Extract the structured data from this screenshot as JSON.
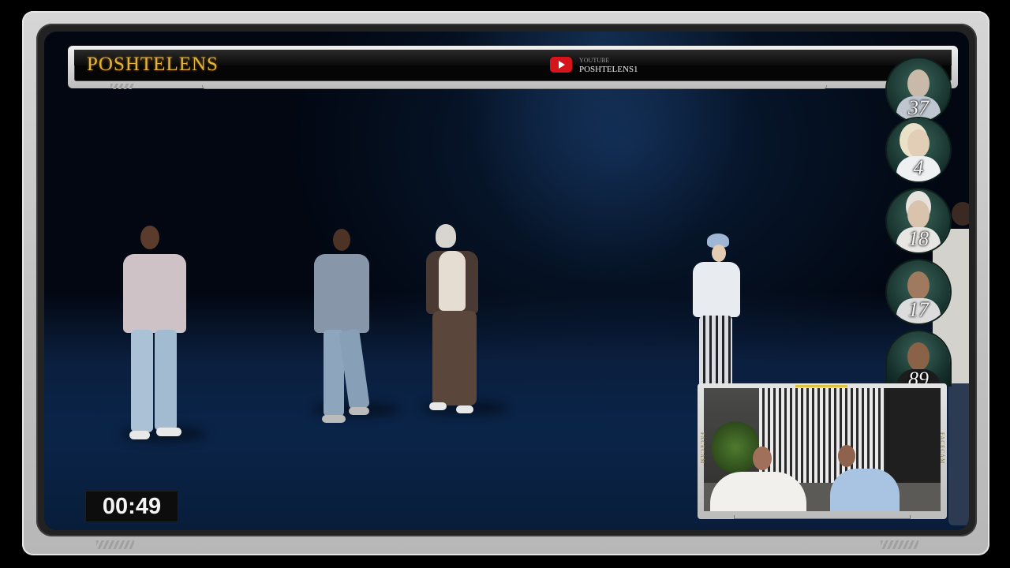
{
  "header": {
    "brand_title": "POSHTELENS",
    "platform_label": "YOUTUBE",
    "channel_handle": "POSHTELENS1",
    "platform_icon": "youtube-icon",
    "accent_color": "#e5b33a"
  },
  "timer": {
    "value": "00:49"
  },
  "contestants": [
    {
      "number": "37"
    },
    {
      "number": "4"
    },
    {
      "number": "18"
    },
    {
      "number": "17"
    },
    {
      "number": "89"
    }
  ],
  "facecam": {
    "label_left": "FACECAM",
    "label_right": "FACECAM"
  }
}
